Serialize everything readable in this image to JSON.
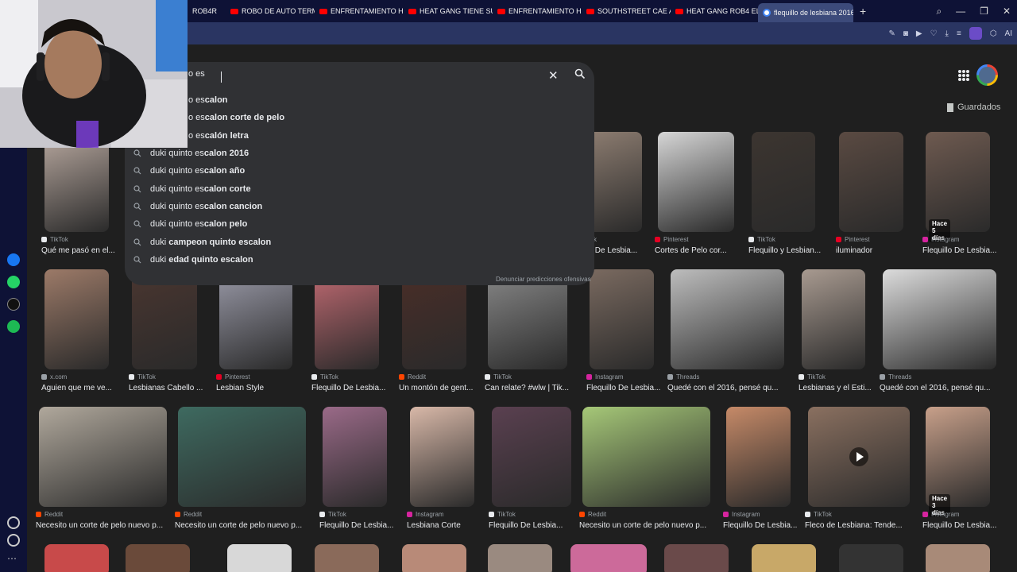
{
  "browser": {
    "tabs": [
      {
        "title": "ROB4R"
      },
      {
        "title": "ROBO DE AUTO TERMINA"
      },
      {
        "title": "ENFRENTAMIENTO HEAT"
      },
      {
        "title": "HEAT GANG TIENE SUS 2"
      },
      {
        "title": "ENFRENTAMIENTO HEAT"
      },
      {
        "title": "SOUTHSTREET CAE AL BA"
      },
      {
        "title": "HEAT GANG ROB4 EL BAN"
      },
      {
        "title": "flequillo de lesbiana 2016"
      }
    ],
    "new_tab_label": "+",
    "toolbar_ai_label": "AI"
  },
  "header": {
    "saved_label": "Guardados"
  },
  "search": {
    "query_visible": "o es",
    "suggestions": [
      {
        "prefix": "o es",
        "bold": "calon",
        "rest": ""
      },
      {
        "prefix": "o es",
        "bold": "calon corte de pelo",
        "rest": ""
      },
      {
        "prefix": "o es",
        "bold": "calón letra",
        "rest": ""
      },
      {
        "prefix": "duki quinto es",
        "bold": "calon 2016",
        "rest": ""
      },
      {
        "prefix": "duki quinto es",
        "bold": "calon año",
        "rest": ""
      },
      {
        "prefix": "duki quinto es",
        "bold": "calon corte",
        "rest": ""
      },
      {
        "prefix": "duki quinto es",
        "bold": "calon cancion",
        "rest": ""
      },
      {
        "prefix": "duki quinto es",
        "bold": "calon pelo",
        "rest": ""
      },
      {
        "prefix": "duki ",
        "bold": "campeon",
        "rest": " quinto escalon"
      },
      {
        "prefix": "duki ",
        "bold": "edad",
        "rest": " quinto escalon"
      }
    ],
    "report_label": "Denunciar predicciones ofensivas"
  },
  "results": [
    {
      "source": "TikTok",
      "title": "Qué me pasó en el..."
    },
    {
      "source": "k",
      "title": "llo De Lesbia..."
    },
    {
      "source": "Pinterest",
      "title": "Cortes de Pelo cor..."
    },
    {
      "source": "TikTok",
      "title": "Flequillo y Lesbian..."
    },
    {
      "source": "Pinterest",
      "title": "iluminador"
    },
    {
      "source": "Instagram",
      "title": "Flequillo De Lesbia...",
      "badge": "Hace 5 días"
    },
    {
      "source": "x.com",
      "title": "Aguien que me ve..."
    },
    {
      "source": "TikTok",
      "title": "Lesbianas Cabello ..."
    },
    {
      "source": "Pinterest",
      "title": "Lesbian Style"
    },
    {
      "source": "TikTok",
      "title": "Flequillo De Lesbia..."
    },
    {
      "source": "Reddit",
      "title": "Un montón de gent..."
    },
    {
      "source": "TikTok",
      "title": "Can relate? #wlw | Tik..."
    },
    {
      "source": "Instagram",
      "title": "Flequillo De Lesbia..."
    },
    {
      "source": "Threads",
      "title": "Quedé con el 2016, pensé qu..."
    },
    {
      "source": "TikTok",
      "title": "Lesbianas y el Esti..."
    },
    {
      "source": "Threads",
      "title": "Quedé con el 2016, pensé qu..."
    },
    {
      "source": "Reddit",
      "title": "Necesito un corte de pelo nuevo p..."
    },
    {
      "source": "Reddit",
      "title": "Necesito un corte de pelo nuevo p..."
    },
    {
      "source": "TikTok",
      "title": "Flequillo De Lesbia..."
    },
    {
      "source": "Instagram",
      "title": "Lesbiana Corte"
    },
    {
      "source": "TikTok",
      "title": "Flequillo De Lesbia..."
    },
    {
      "source": "Reddit",
      "title": "Necesito un corte de pelo nuevo p..."
    },
    {
      "source": "Instagram",
      "title": "Flequillo De Lesbia..."
    },
    {
      "source": "TikTok",
      "title": "Fleco de Lesbiana: Tende..."
    },
    {
      "source": "Instagram",
      "title": "Flequillo De Lesbia...",
      "badge": "Hace 3 días"
    }
  ],
  "colors": {
    "tiktok": "#e8eaed",
    "pinterest": "#e60023",
    "instagram": "#d6249f",
    "reddit": "#ff4500",
    "threads": "#9aa0a6",
    "x": "#9aa0a6"
  }
}
